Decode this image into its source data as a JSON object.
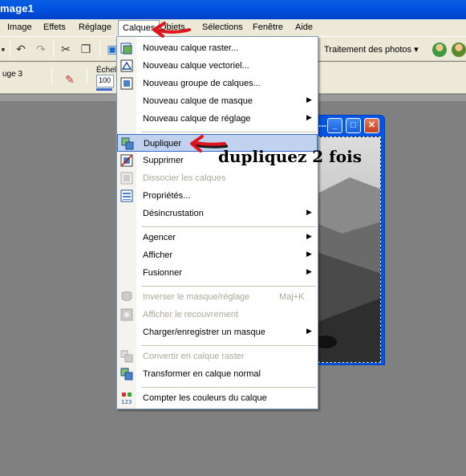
{
  "window": {
    "title": "mage1"
  },
  "menubar": {
    "items": [
      {
        "label": "Image"
      },
      {
        "label": "Effets"
      },
      {
        "label": "Réglage"
      },
      {
        "label": "Calques"
      },
      {
        "label": "Objets"
      },
      {
        "label": "Sélections"
      },
      {
        "label": "Fenêtre"
      },
      {
        "label": "Aide"
      }
    ]
  },
  "toolbar": {
    "photo_button": "Traitement des photos",
    "label_left": "uge 3",
    "scale_label": "Échell",
    "scale_value": "100"
  },
  "image_window": {
    "title": "..."
  },
  "dropdown": {
    "items": [
      {
        "label": "Nouveau calque raster...",
        "enabled": true,
        "submenu": false
      },
      {
        "label": "Nouveau calque vectoriel...",
        "enabled": true,
        "submenu": false
      },
      {
        "label": "Nouveau groupe de calques...",
        "enabled": true,
        "submenu": false
      },
      {
        "label": "Nouveau calque de masque",
        "enabled": true,
        "submenu": true
      },
      {
        "label": "Nouveau calque de réglage",
        "enabled": true,
        "submenu": true
      },
      {
        "label": "Dupliquer",
        "enabled": true,
        "submenu": false,
        "highlighted": true
      },
      {
        "label": "Supprimer",
        "enabled": true,
        "submenu": false
      },
      {
        "label": "Dissocier les calques",
        "enabled": false,
        "submenu": false
      },
      {
        "label": "Propriétés...",
        "enabled": true,
        "submenu": false
      },
      {
        "label": "Désincrustation",
        "enabled": true,
        "submenu": true
      },
      {
        "label": "Agencer",
        "enabled": true,
        "submenu": true
      },
      {
        "label": "Afficher",
        "enabled": true,
        "submenu": true
      },
      {
        "label": "Fusionner",
        "enabled": true,
        "submenu": true
      },
      {
        "label": "Inverser le masque/réglage",
        "enabled": false,
        "submenu": false,
        "shortcut": "Maj+K"
      },
      {
        "label": "Afficher le recouvrement",
        "enabled": false,
        "submenu": false
      },
      {
        "label": "Charger/enregistrer un masque",
        "enabled": true,
        "submenu": true
      },
      {
        "label": "Convertir en calque raster",
        "enabled": false,
        "submenu": false
      },
      {
        "label": "Transformer en calque normal",
        "enabled": true,
        "submenu": false
      },
      {
        "label": "Compter les couleurs du calque",
        "enabled": true,
        "submenu": false
      }
    ]
  },
  "annotation": {
    "text": "dupliquez 2 fois"
  },
  "colors": {
    "accent": "#0054e3",
    "menu_highlight": "#c1d2ee",
    "arrow": "#e0141e",
    "workspace": "#808080"
  }
}
